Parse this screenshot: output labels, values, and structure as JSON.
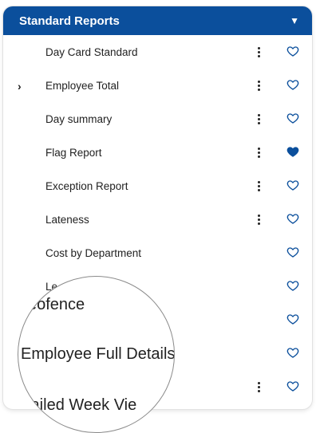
{
  "header": {
    "title": "Standard Reports",
    "caret": "▼"
  },
  "colors": {
    "brand": "#0b4f9c",
    "heart_outline": "#0b4f9c",
    "heart_filled": "#0b4f9c"
  },
  "rows": [
    {
      "label": "Day Card Standard",
      "menu": true,
      "favorited": false,
      "expandable": false
    },
    {
      "label": "Employee Total",
      "menu": true,
      "favorited": false,
      "expandable": true,
      "expander": "›"
    },
    {
      "label": "Day summary",
      "menu": true,
      "favorited": false,
      "expandable": false
    },
    {
      "label": "Flag Report",
      "menu": true,
      "favorited": true,
      "expandable": false
    },
    {
      "label": "Exception Report",
      "menu": true,
      "favorited": false,
      "expandable": false
    },
    {
      "label": "Lateness",
      "menu": true,
      "favorited": false,
      "expandable": false
    },
    {
      "label": "Cost by Department",
      "menu": false,
      "favorited": false,
      "expandable": false
    },
    {
      "label": "Le... Report",
      "menu": false,
      "favorited": false,
      "expandable": false
    },
    {
      "label": "",
      "menu": false,
      "favorited": false,
      "expandable": false
    },
    {
      "label": "",
      "menu": false,
      "favorited": false,
      "expandable": false
    },
    {
      "label": "",
      "menu": true,
      "favorited": false,
      "expandable": false
    }
  ],
  "magnifier": {
    "lines": [
      "eofence",
      "Employee Full Details",
      "tailed Week Vie"
    ]
  }
}
